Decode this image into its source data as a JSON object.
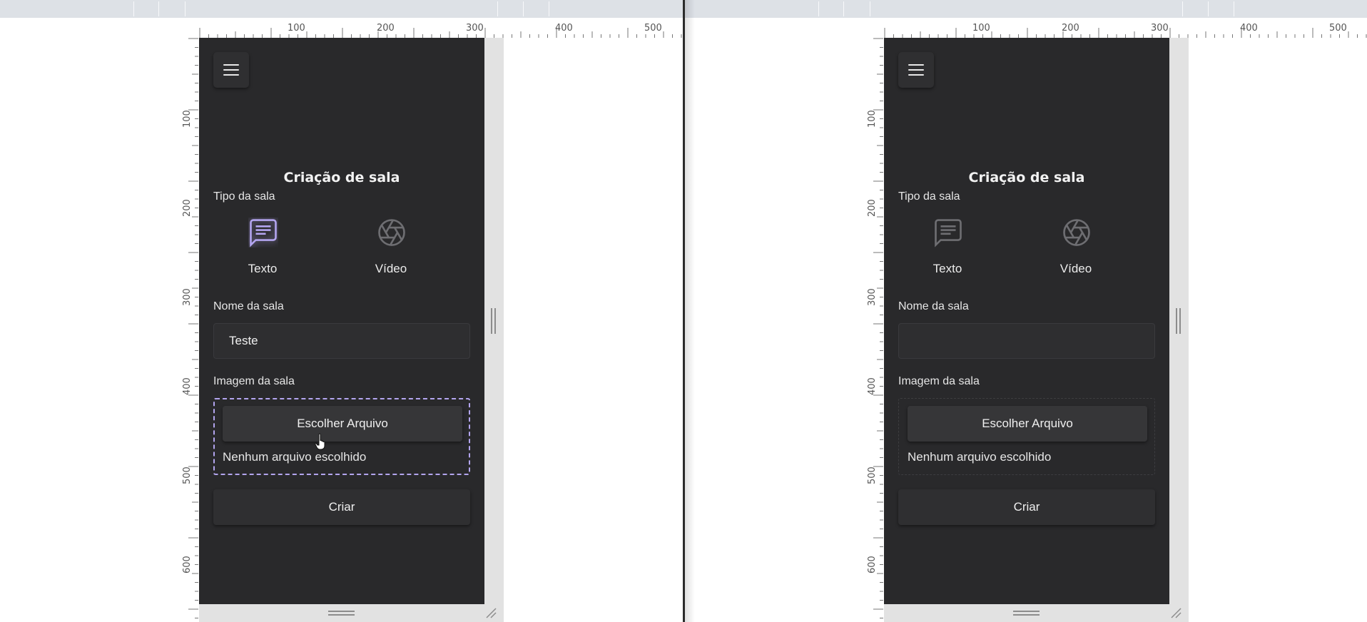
{
  "panels": [
    {
      "id": "left",
      "ruler": {
        "top_labels": [
          "100",
          "200",
          "300",
          "400",
          "500"
        ],
        "left_labels": [
          "100",
          "200",
          "300",
          "400",
          "500",
          "600"
        ]
      },
      "menu_icon": "hamburger-icon",
      "title": "Criação de sala",
      "room_type_label": "Tipo da sala",
      "room_types": [
        {
          "label": "Texto",
          "icon": "chat-icon",
          "selected": true
        },
        {
          "label": "Vídeo",
          "icon": "camera-aperture-icon",
          "selected": false
        }
      ],
      "room_name_label": "Nome da sala",
      "room_name_value": "Teste",
      "room_name_placeholder": "",
      "room_image_label": "Imagem da sala",
      "choose_file_label": "Escolher Arquivo",
      "file_status": "Nenhum arquivo escolhido",
      "dropzone_state": "active",
      "create_label": "Criar",
      "cursor_icon": "hand-pointer-icon"
    },
    {
      "id": "right",
      "ruler": {
        "top_labels": [
          "100",
          "200",
          "300",
          "400",
          "500"
        ],
        "left_labels": [
          "100",
          "200",
          "300",
          "400",
          "500",
          "600"
        ]
      },
      "menu_icon": "hamburger-icon",
      "title": "Criação de sala",
      "room_type_label": "Tipo da sala",
      "room_types": [
        {
          "label": "Texto",
          "icon": "chat-icon",
          "selected": false
        },
        {
          "label": "Vídeo",
          "icon": "camera-aperture-icon",
          "selected": false
        }
      ],
      "room_name_label": "Nome da sala",
      "room_name_value": "",
      "room_name_placeholder": "",
      "room_image_label": "Imagem da sala",
      "choose_file_label": "Escolher Arquivo",
      "file_status": "Nenhum arquivo escolhido",
      "dropzone_state": "idle",
      "create_label": "Criar"
    }
  ],
  "colors": {
    "background": "#29292b",
    "accent": "#b3a5ef",
    "text": "#f2f2f2",
    "icon_inactive": "#6e6e72"
  }
}
